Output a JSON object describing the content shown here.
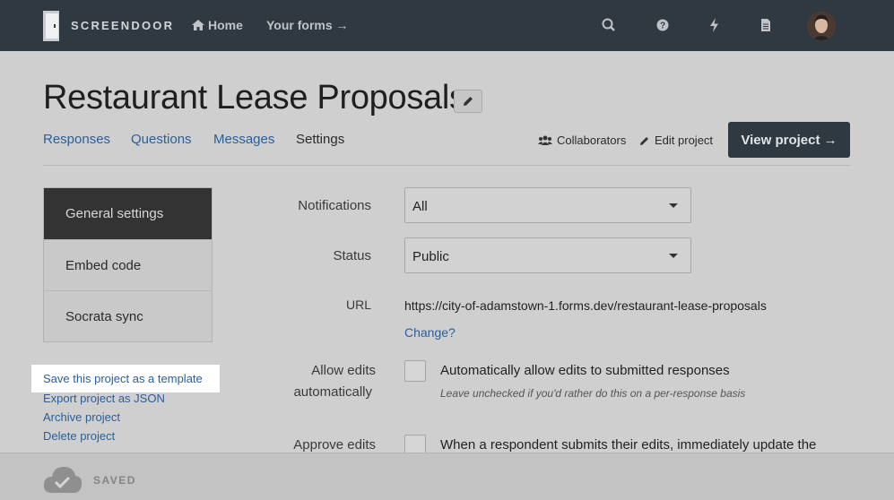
{
  "nav": {
    "brand": "SCREENDOOR",
    "home_label": "Home",
    "forms_label": "Your forms →",
    "icons": [
      "search-icon",
      "help-icon",
      "bolt-icon",
      "document-icon"
    ]
  },
  "header": {
    "title": "Restaurant Lease Proposals",
    "tabs": [
      {
        "label": "Responses"
      },
      {
        "label": "Questions"
      },
      {
        "label": "Messages"
      },
      {
        "label": "Settings"
      }
    ],
    "collaborators_label": "Collaborators",
    "edit_project_label": "Edit project",
    "view_project_label": "View project →"
  },
  "sidebar": {
    "items": [
      {
        "label": "General settings",
        "active": true
      },
      {
        "label": "Embed code"
      },
      {
        "label": "Socrata sync"
      }
    ],
    "actions": [
      {
        "label": "Save this project as a template"
      },
      {
        "label": "Export project as JSON"
      },
      {
        "label": "Archive project"
      },
      {
        "label": "Delete project"
      }
    ]
  },
  "form": {
    "notifications": {
      "label": "Notifications",
      "value": "All"
    },
    "status": {
      "label": "Status",
      "value": "Public"
    },
    "url": {
      "label": "URL",
      "value": "https://city-of-adamstown-1.forms.dev/restaurant-lease-proposals",
      "change_label": "Change?"
    },
    "allow_edits": {
      "label_line1": "Allow edits",
      "label_line2": "automatically",
      "checkbox_label": "Automatically allow edits to submitted responses",
      "hint": "Leave unchecked if you'd rather do this on a per-response basis"
    },
    "approve_edits": {
      "label": "Approve edits",
      "checkbox_label": "When a respondent submits their edits, immediately update the"
    }
  },
  "footer": {
    "status": "SAVED"
  },
  "colors": {
    "nav_bg": "#303942",
    "link": "#2b5e9a",
    "active_menu": "#333333",
    "button_bg": "#2f3942"
  }
}
